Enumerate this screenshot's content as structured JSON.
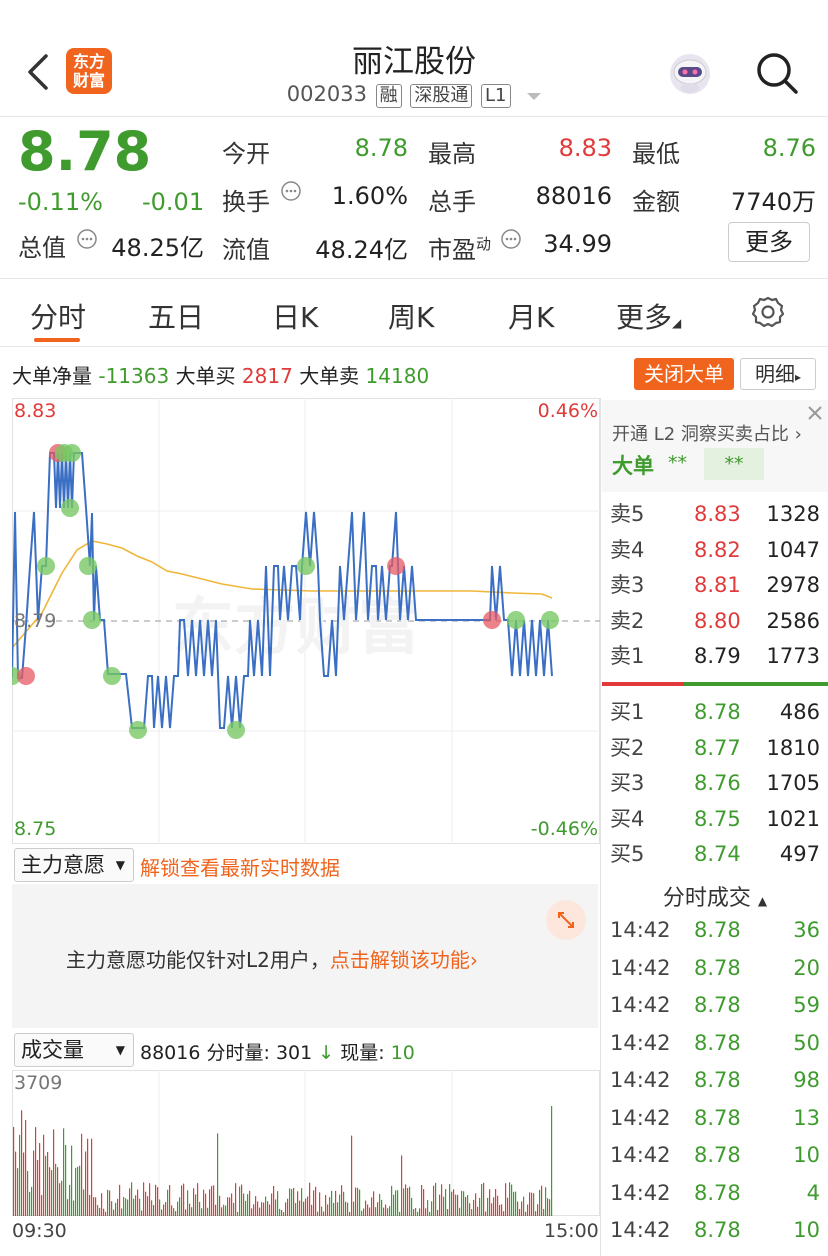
{
  "header": {
    "title": "丽江股份",
    "code": "002033",
    "tags": [
      "融",
      "深股通",
      "L1"
    ],
    "logo_text": [
      "东方",
      "财富"
    ]
  },
  "quote": {
    "price": "8.78",
    "change_pct": "-0.11%",
    "change_abs": "-0.01",
    "market_cap_label": "总值",
    "market_cap": "48.25亿",
    "open_label": "今开",
    "open": "8.78",
    "high_label": "最高",
    "high": "8.83",
    "low_label": "最低",
    "low": "8.76",
    "turnover_label": "换手",
    "turnover": "1.60%",
    "volume_label": "总手",
    "volume": "88016",
    "amount_label": "金额",
    "amount": "7740万",
    "float_cap_label": "流值",
    "float_cap": "48.24亿",
    "pe_label": "市盈",
    "pe_sup": "动",
    "pe": "34.99",
    "more_label": "更多"
  },
  "tabs": [
    "分时",
    "五日",
    "日K",
    "周K",
    "月K",
    "更多"
  ],
  "big_order": {
    "net_label": "大单净量",
    "net": "-11363",
    "buy_label": "大单买",
    "buy": "2817",
    "sell_label": "大单卖",
    "sell": "14180",
    "close_btn": "关闭大单",
    "detail_btn": "明细"
  },
  "chart_labels": {
    "top_price": "8.83",
    "top_pct": "0.46%",
    "mid_price": "8.79",
    "bottom_price": "8.75",
    "bottom_pct": "-0.46%",
    "watermark": "东方财富"
  },
  "wish": {
    "select": "主力意愿",
    "unlock": "解锁查看最新实时数据",
    "notice": "主力意愿功能仅针对L2用户，",
    "notice_link": "点击解锁该功能"
  },
  "volume": {
    "select": "成交量",
    "total": "88016",
    "minute_label": "分时量:",
    "minute": "301",
    "now_label": "现量:",
    "now": "10",
    "max_label": "3709",
    "time_start": "09:30",
    "time_end": "15:00"
  },
  "l2": {
    "promo": "开通 L2 洞察买卖占比",
    "big_label": "大单",
    "stars1": "**",
    "stars2": "**"
  },
  "order_book": {
    "sells": [
      {
        "label": "卖5",
        "price": "8.83",
        "vol": "1328"
      },
      {
        "label": "卖4",
        "price": "8.82",
        "vol": "1047"
      },
      {
        "label": "卖3",
        "price": "8.81",
        "vol": "2978"
      },
      {
        "label": "卖2",
        "price": "8.80",
        "vol": "2586"
      },
      {
        "label": "卖1",
        "price": "8.79",
        "vol": "1773"
      }
    ],
    "buys": [
      {
        "label": "买1",
        "price": "8.78",
        "vol": "486"
      },
      {
        "label": "买2",
        "price": "8.77",
        "vol": "1810"
      },
      {
        "label": "买3",
        "price": "8.76",
        "vol": "1705"
      },
      {
        "label": "买4",
        "price": "8.75",
        "vol": "1021"
      },
      {
        "label": "买5",
        "price": "8.74",
        "vol": "497"
      }
    ]
  },
  "ticks": {
    "title": "分时成交",
    "rows": [
      {
        "time": "14:42",
        "price": "8.78",
        "vol": "36"
      },
      {
        "time": "14:42",
        "price": "8.78",
        "vol": "20"
      },
      {
        "time": "14:42",
        "price": "8.78",
        "vol": "59"
      },
      {
        "time": "14:42",
        "price": "8.78",
        "vol": "50"
      },
      {
        "time": "14:42",
        "price": "8.78",
        "vol": "98"
      },
      {
        "time": "14:42",
        "price": "8.78",
        "vol": "13"
      },
      {
        "time": "14:42",
        "price": "8.78",
        "vol": "10"
      },
      {
        "time": "14:42",
        "price": "8.78",
        "vol": "4"
      },
      {
        "time": "14:42",
        "price": "8.78",
        "vol": "10"
      }
    ]
  },
  "colors": {
    "up": "#e03a3a",
    "down": "#3f9b2e",
    "accent": "#f0641e",
    "price_line": "#3a6fc4",
    "avg_line": "#f0b63a"
  }
}
